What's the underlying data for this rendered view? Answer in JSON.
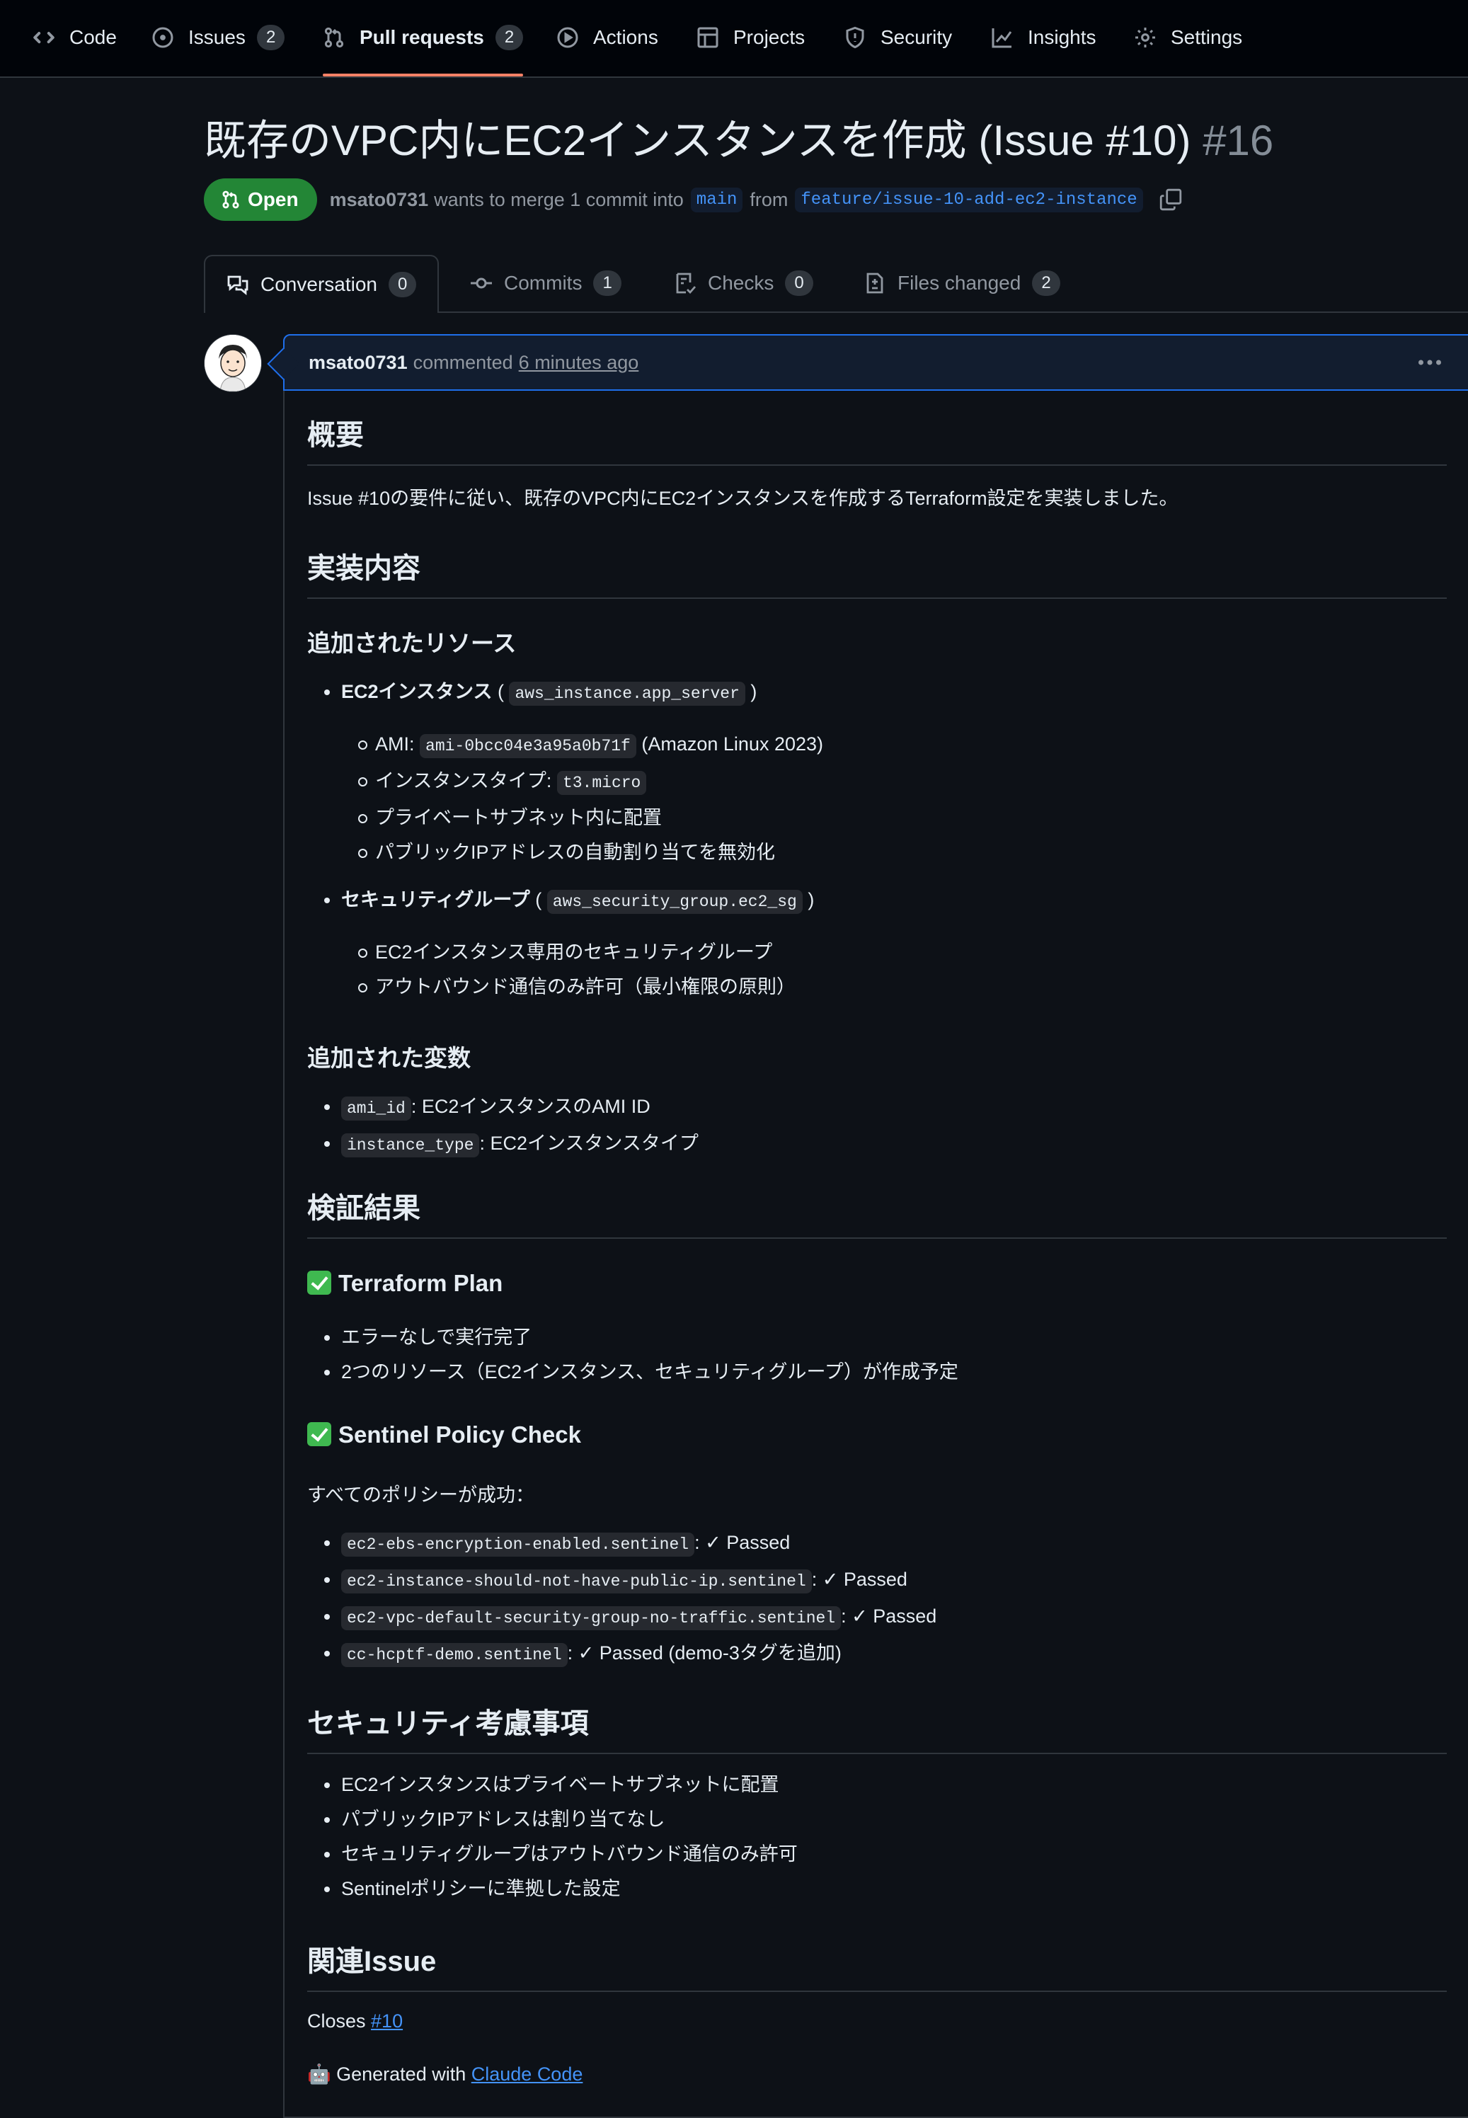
{
  "repo_nav": {
    "tabs": [
      {
        "label": "Code",
        "icon": "code-icon"
      },
      {
        "label": "Issues",
        "icon": "issue-opened-icon",
        "count": "2"
      },
      {
        "label": "Pull requests",
        "icon": "git-pull-request-icon",
        "count": "2",
        "selected": true
      },
      {
        "label": "Actions",
        "icon": "play-icon"
      },
      {
        "label": "Projects",
        "icon": "table-icon"
      },
      {
        "label": "Security",
        "icon": "shield-icon"
      },
      {
        "label": "Insights",
        "icon": "graph-icon"
      },
      {
        "label": "Settings",
        "icon": "gear-icon"
      }
    ]
  },
  "pr": {
    "title": "既存のVPC内にEC2インスタンスを作成 (Issue #10)",
    "number": "#16",
    "state": "Open",
    "author": "msato0731",
    "merge_text": "wants to merge 1 commit into",
    "base_branch": "main",
    "from_text": "from",
    "head_branch": "feature/issue-10-add-ec2-instance"
  },
  "pr_tabs": [
    {
      "label": "Conversation",
      "count": "0",
      "icon": "comment-discussion-icon",
      "active": true
    },
    {
      "label": "Commits",
      "count": "1",
      "icon": "git-commit-icon"
    },
    {
      "label": "Checks",
      "count": "0",
      "icon": "checklist-icon"
    },
    {
      "label": "Files changed",
      "count": "2",
      "icon": "file-diff-icon"
    }
  ],
  "comment": {
    "author": "msato0731",
    "action": "commented",
    "time": "6 minutes ago"
  },
  "body": {
    "overview_heading": "概要",
    "overview_text": "Issue #10の要件に従い、既存のVPC内にEC2インスタンスを作成するTerraform設定を実装しました。",
    "impl_heading": "実装内容",
    "added_resources_heading": "追加されたリソース",
    "res1_label": "EC2インスタンス",
    "res1_code": "aws_instance.app_server",
    "res1_items": {
      "ami_label": "AMI: ",
      "ami_code": "ami-0bcc04e3a95a0b71f",
      "ami_suffix": " (Amazon Linux 2023)",
      "type_label": "インスタンスタイプ: ",
      "type_code": "t3.micro",
      "private": "プライベートサブネット内に配置",
      "public_ip": "パブリックIPアドレスの自動割り当てを無効化"
    },
    "res2_label": "セキュリティグループ",
    "res2_code": "aws_security_group.ec2_sg",
    "res2_items": [
      "EC2インスタンス専用のセキュリティグループ",
      "アウトバウンド通信のみ許可（最小権限の原則）"
    ],
    "vars_heading": "追加された変数",
    "vars": [
      {
        "code": "ami_id",
        "text": ": EC2インスタンスのAMI ID"
      },
      {
        "code": "instance_type",
        "text": ": EC2インスタンスタイプ"
      }
    ],
    "verify_heading": "検証結果",
    "plan_heading": "Terraform Plan",
    "plan_items": [
      "エラーなしで実行完了",
      "2つのリソース（EC2インスタンス、セキュリティグループ）が作成予定"
    ],
    "sentinel_heading": "Sentinel Policy Check",
    "sentinel_intro": "すべてのポリシーが成功：",
    "sentinel_items": [
      {
        "code": "ec2-ebs-encryption-enabled.sentinel",
        "text": ": ✓ Passed"
      },
      {
        "code": "ec2-instance-should-not-have-public-ip.sentinel",
        "text": ": ✓ Passed"
      },
      {
        "code": "ec2-vpc-default-security-group-no-traffic.sentinel",
        "text": ": ✓ Passed"
      },
      {
        "code": "cc-hcptf-demo.sentinel",
        "text": ": ✓ Passed (demo-3タグを追加)"
      }
    ],
    "security_heading": "セキュリティ考慮事項",
    "security_items": [
      "EC2インスタンスはプライベートサブネットに配置",
      "パブリックIPアドレスは割り当てなし",
      "セキュリティグループはアウトバウンド通信のみ許可",
      "Sentinelポリシーに準拠した設定"
    ],
    "related_heading": "関連Issue",
    "closes_text": "Closes ",
    "closes_link": "#10",
    "generated_emoji": "🤖",
    "generated_text": " Generated with ",
    "generated_link": "Claude Code"
  },
  "colors": {
    "background": "#0d1117",
    "open_badge": "#238636",
    "link": "#4493f8",
    "selected_underline": "#f78166"
  }
}
